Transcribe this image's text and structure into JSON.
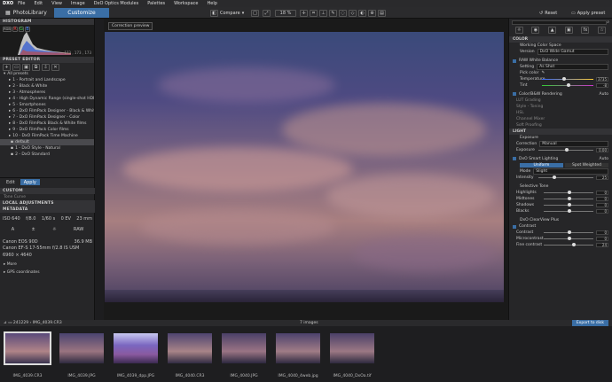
{
  "menu": {
    "app": "DXO",
    "items": [
      "File",
      "Edit",
      "View",
      "Image",
      "DxO Optics Modules",
      "Palettes",
      "Workspace",
      "Help"
    ]
  },
  "toolbar": {
    "tab_library": "PhotoLibrary",
    "tab_customize": "Customize",
    "compare": "Compare",
    "zoom": "18 %",
    "reset": "Reset",
    "apply_preset": "Apply preset"
  },
  "left": {
    "histogram_title": "HISTOGRAM",
    "histogram_readout": "173 , 173 , 173",
    "preset_title": "PRESET EDITOR",
    "presets": [
      "All presets",
      "1 - Portrait and Landscape",
      "2 - Black & White",
      "3 - Atmospheres",
      "4 - High Dynamic Range (single-shot HDR)",
      "5 - Smartphones",
      "6 - DxO FilmPack Designer - Black & White",
      "7 - DxO FilmPack Designer - Color",
      "8 - DxO FilmPack Black & White films",
      "9 - DxO FilmPack Color films",
      "10 - DxO FilmPack Time Machine",
      "default",
      "1 - DxO Style - Natural",
      "2 - DxO Standard"
    ],
    "edit": "Edit",
    "apply": "Apply",
    "custom_title": "CUSTOM",
    "tone_curve": "Tone Curve",
    "local_title": "LOCAL ADJUSTMENTS",
    "meta_title": "METADATA",
    "meta_values": [
      "ISO 640",
      "f/8.0",
      "1/60 s",
      "0 EV",
      "23 mm"
    ],
    "meta_icons": [
      "A",
      "±",
      "☼",
      "RAW"
    ],
    "camera": "Canon EOS 90D",
    "size": "36.9 MB",
    "lens": "Canon EF-S 17-55mm f/2.8 IS USM",
    "dims": "6960 × 4640",
    "more": "More",
    "gps": "GPS coordinates"
  },
  "center": {
    "correction": "Correction preview"
  },
  "right": {
    "color_title": "COLOR",
    "working_color_space": "Working Color Space",
    "version_label": "Version",
    "version_value": "DxO Wide Gamut",
    "raw_wb": "RAW White Balance",
    "setting_label": "Setting",
    "setting_value": "As Shot",
    "pick_color": "Pick color",
    "temperature_label": "Temperature",
    "temperature_value": "3735",
    "tint_label": "Tint",
    "tint_value": "-8",
    "color_rendering": "Color/B&W Rendering",
    "auto": "Auto",
    "sub": [
      "LUT Grading",
      "Style - Toning",
      "HSL",
      "Channel Mixer",
      "Soft Proofing"
    ],
    "light_title": "LIGHT",
    "exposure_head": "Exposure",
    "correction_label": "Correction",
    "correction_value": "Manual",
    "exposure_label": "Exposure",
    "exposure_value": "0.00",
    "smart_lighting": "DxO Smart Lighting",
    "uniform": "Uniform",
    "spot": "Spot Weighted",
    "mode_label": "Mode",
    "mode_value": "Slight",
    "intensity_label": "Intensity",
    "intensity_value": "25",
    "selective_tone": "Selective Tone",
    "tone_rows": [
      {
        "label": "Highlights",
        "value": "0"
      },
      {
        "label": "Midtones",
        "value": "0"
      },
      {
        "label": "Shadows",
        "value": "0"
      },
      {
        "label": "Blacks",
        "value": "0"
      }
    ],
    "clearview": "DxO ClearView Plus",
    "contrast": "Contrast",
    "contrast_rows": [
      {
        "label": "Contrast",
        "value": "0"
      },
      {
        "label": "Microcontrast",
        "value": "0"
      },
      {
        "label": "Fine contrast",
        "value": "24"
      }
    ]
  },
  "bottom": {
    "path": "241229 › IMG_4039.CR3",
    "count": "7 images",
    "export": "Export to disk",
    "thumbs": [
      "IMG_4039.CR3",
      "IMG_4039.JPG",
      "IMG_4039_dpp.JPG",
      "IMG_4040.CR3",
      "IMG_4040.JPG",
      "IMG_4040_4web.jpg",
      "IMG_4040_DxOa.tif"
    ]
  }
}
